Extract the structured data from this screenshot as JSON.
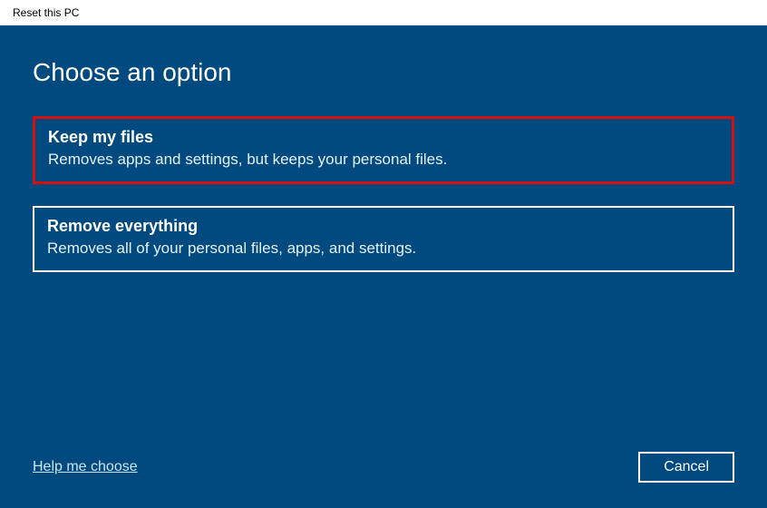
{
  "window_title": "Reset this PC",
  "page_title": "Choose an option",
  "options": [
    {
      "title": "Keep my files",
      "description": "Removes apps and settings, but keeps your personal files.",
      "highlighted": true
    },
    {
      "title": "Remove everything",
      "description": "Removes all of your personal files, apps, and settings.",
      "highlighted": false
    }
  ],
  "help_link": "Help me choose",
  "cancel_button": "Cancel"
}
